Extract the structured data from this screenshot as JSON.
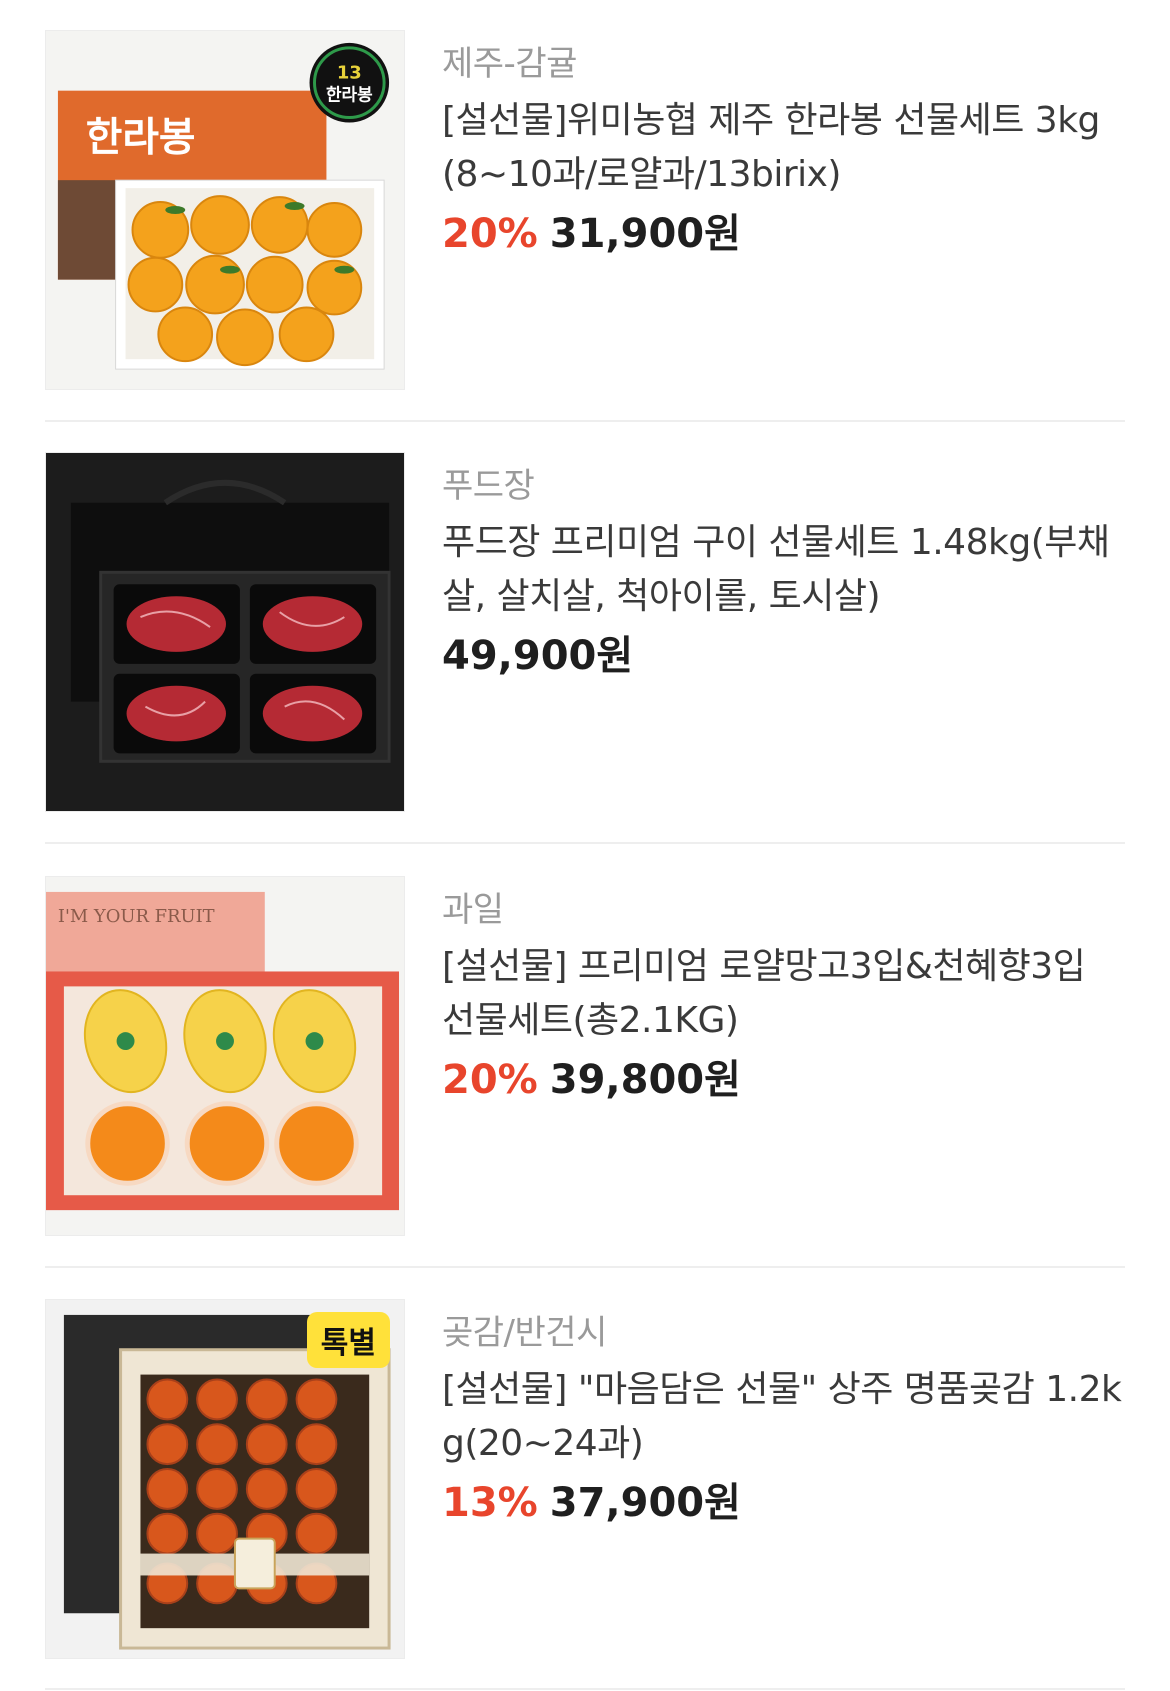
{
  "products": [
    {
      "category": "제주-감귤",
      "title": "[설선물]위미농협 제주 한라봉 선물세트 3kg(8~10과/로얄과/13birix)",
      "discount": "20%",
      "price": "31,900원",
      "image_text": [
        "한라봉",
        "13 brix 이상 한라봉"
      ]
    },
    {
      "category": "푸드장",
      "title": "푸드장 프리미엄 구이 선물세트 1.48kg(부채살, 살치살, 척아이롤, 토시살)",
      "discount": "",
      "price": "49,900원"
    },
    {
      "category": "과일",
      "title": "[설선물] 프리미엄 로얄망고3입&천혜향3입 선물세트(총2.1KG)",
      "discount": "20%",
      "price": "39,800원",
      "image_text": [
        "I'M YOUR FRUIT"
      ]
    },
    {
      "category": "곶감/반건시",
      "title": "[설선물] \"마음담은 선물\" 상주 명품곶감 1.2kg(20~24과)",
      "discount": "13%",
      "price": "37,900원",
      "badge": "톡별"
    }
  ],
  "colors": {
    "discount": "#e8452c",
    "badge_bg": "#ffe13a",
    "category": "#9a9a9a"
  }
}
